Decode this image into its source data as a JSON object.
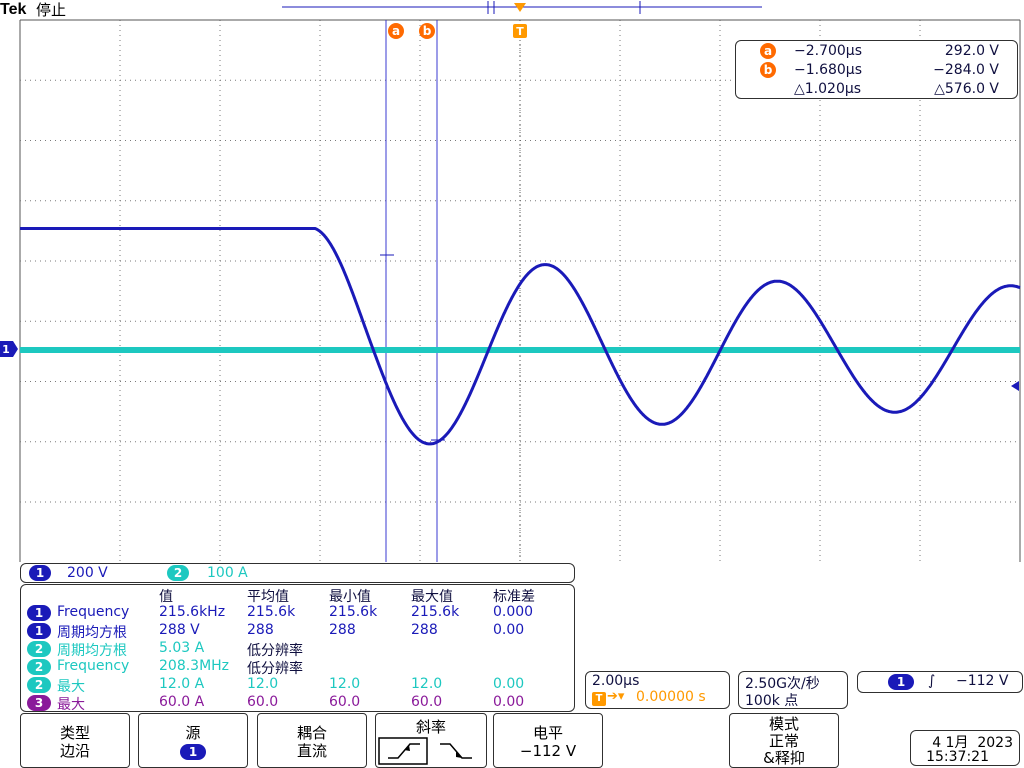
{
  "header": {
    "brand": "Tek",
    "run_state": "停止"
  },
  "markers": {
    "cursor_a": "a",
    "cursor_b": "b",
    "trigger": "T",
    "channel1": "1"
  },
  "cursor_readout": {
    "a": {
      "time": "−2.700µs",
      "value": "292.0 V"
    },
    "b": {
      "time": "−1.680µs",
      "value": "−284.0 V"
    },
    "delta": {
      "time": "△1.020µs",
      "value": "△576.0 V"
    }
  },
  "scales": {
    "ch1": {
      "num": "1",
      "value": "200 V"
    },
    "ch2": {
      "num": "2",
      "value": "100 A"
    }
  },
  "measurements": {
    "headers": [
      "值",
      "平均值",
      "最小值",
      "最大值",
      "标准差"
    ],
    "rows": [
      {
        "ch": "1",
        "name": "Frequency",
        "value": "215.6kHz",
        "mean": "215.6k",
        "min": "215.6k",
        "max": "215.6k",
        "std": "0.000"
      },
      {
        "ch": "1",
        "name": "周期均方根",
        "value": "288 V",
        "mean": "288",
        "min": "288",
        "max": "288",
        "std": "0.00"
      },
      {
        "ch": "2",
        "name": "周期均方根",
        "value": "5.03 A",
        "mean": "低分辨率",
        "min": "",
        "max": "",
        "std": ""
      },
      {
        "ch": "2",
        "name": "Frequency",
        "value": "208.3MHz",
        "mean": "低分辨率",
        "min": "",
        "max": "",
        "std": ""
      },
      {
        "ch": "2",
        "name": "最大",
        "value": "12.0 A",
        "mean": "12.0",
        "min": "12.0",
        "max": "12.0",
        "std": "0.00"
      },
      {
        "ch": "3",
        "name": "最大",
        "value": "60.0 A",
        "mean": "60.0",
        "min": "60.0",
        "max": "60.0",
        "std": "0.00"
      }
    ]
  },
  "timebase": {
    "scale": "2.00µs",
    "trigger_pos_icon": "T",
    "position": "0.00000 s"
  },
  "sample": {
    "rate": "2.50G次/秒",
    "points": "100k 点"
  },
  "trigger_status": {
    "ch": "1",
    "slope_glyph": "∫",
    "level": "−112 V"
  },
  "menu": {
    "type": {
      "title": "类型",
      "value": "边沿"
    },
    "source": {
      "title": "源",
      "value": "1"
    },
    "coupling": {
      "title": "耦合",
      "value": "直流"
    },
    "slope": {
      "title": "斜率"
    },
    "level": {
      "title": "电平",
      "value": "−112 V"
    },
    "mode": {
      "title": "模式",
      "value": "正常",
      "value2": "&释抑"
    }
  },
  "datetime": {
    "date": "4 1月  2023",
    "time": "15:37:21"
  },
  "colors": {
    "ch1": "#1a1ab8",
    "ch2": "#1dc8c0",
    "ch3": "#8a1a9a",
    "cursor": "#ff6a00",
    "trigger": "#ff9900"
  },
  "waveform_ch1": {
    "flat_level_v": 400,
    "drop_start_us": -4.1,
    "oscillation_peaks_v": [
      -330,
      300,
      -260,
      240,
      -210
    ],
    "frequency_khz": 215.6
  },
  "waveform_ch2": {
    "level_a": 0
  }
}
